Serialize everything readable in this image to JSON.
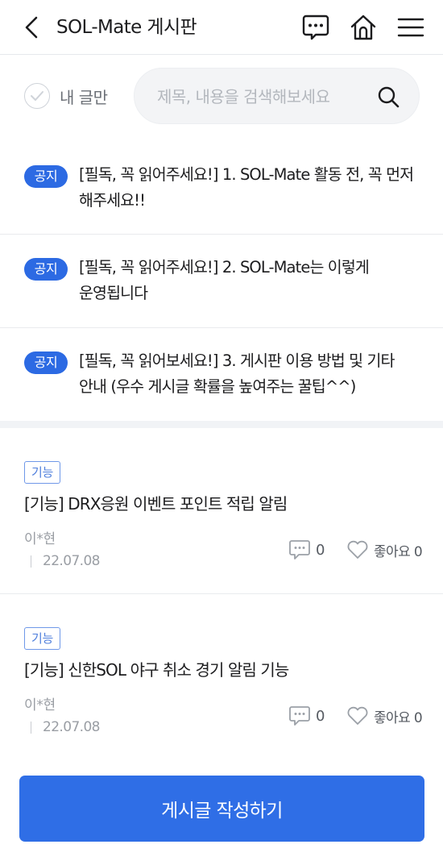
{
  "header": {
    "title": "SOL-Mate 게시판",
    "back_icon": "chevron-left-icon",
    "chat_icon": "chat-bubble-icon",
    "home_icon": "home-icon",
    "menu_icon": "hamburger-menu-icon"
  },
  "filter": {
    "mine_only_label": "내 글만",
    "mine_only_checked": false
  },
  "search": {
    "placeholder": "제목, 내용을 검색해보세요",
    "value": ""
  },
  "notices": [
    {
      "badge": "공지",
      "title": "[필독, 꼭 읽어주세요!] 1. SOL-Mate 활동 전, 꼭 먼저 해주세요!!"
    },
    {
      "badge": "공지",
      "title": "[필독, 꼭 읽어주세요!] 2. SOL-Mate는 이렇게 운영됩니다"
    },
    {
      "badge": "공지",
      "title": "[필독, 꼭 읽어보세요!] 3. 게시판 이용 방법 및 기타 안내 (우수 게시글 확률을 높여주는 꿀팁^^)"
    }
  ],
  "posts": [
    {
      "tag": "기능",
      "title": "[기능] DRX응원 이벤트 포인트 적립 알림",
      "author": "이*현",
      "date": "22.07.08",
      "comments": "0",
      "likes_label": "좋아요 0"
    },
    {
      "tag": "기능",
      "title": "[기능] 신한SOL 야구 취소 경기 알림 기능",
      "author": "이*현",
      "date": "22.07.08",
      "comments": "0",
      "likes_label": "좋아요 0"
    }
  ],
  "write_button": {
    "label": "게시글 작성하기"
  },
  "colors": {
    "accent": "#2f6ee6",
    "badge": "#2c6ae3",
    "tag_border": "#6f98e8"
  }
}
